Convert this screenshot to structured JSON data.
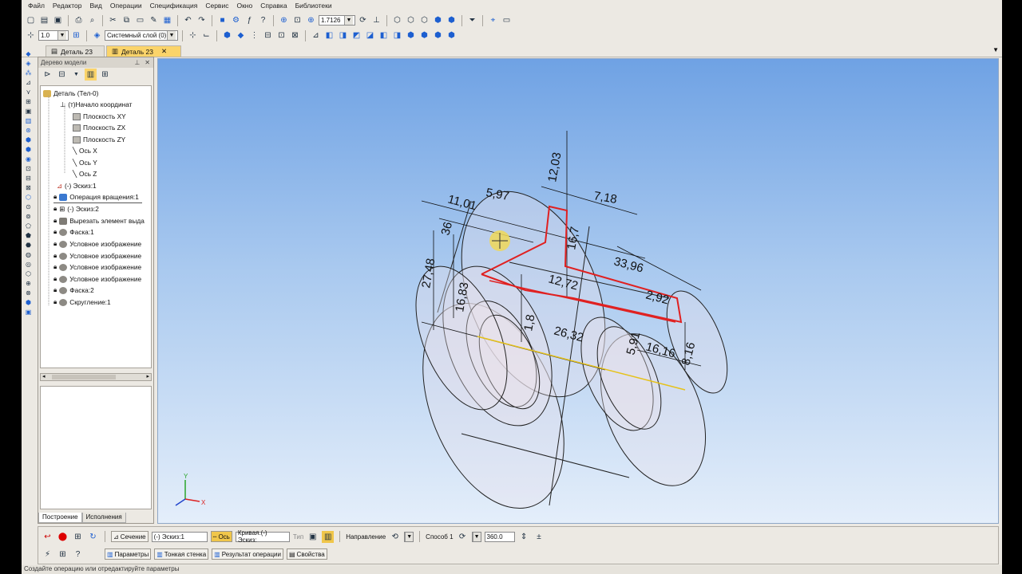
{
  "menu": {
    "items": [
      "Файл",
      "Редактор",
      "Вид",
      "Операции",
      "Спецификация",
      "Сервис",
      "Окно",
      "Справка",
      "Библиотеки"
    ]
  },
  "toolbar": {
    "zoom_value": "1.7126",
    "step_value": "1.0",
    "layer_value": "Системный слой (0)"
  },
  "tabs": [
    {
      "label": "Деталь 23",
      "active": false
    },
    {
      "label": "Деталь 23",
      "active": true
    }
  ],
  "tree_panel": {
    "title": "Дерево модели",
    "bottom_tabs": [
      "Построение",
      "Исполнения"
    ],
    "items": [
      {
        "label": "Деталь (Тел-0)"
      },
      {
        "label": "(т)Начало координат"
      },
      {
        "label": "Плоскость XY"
      },
      {
        "label": "Плоскость ZX"
      },
      {
        "label": "Плоскость ZY"
      },
      {
        "label": "Ось X"
      },
      {
        "label": "Ось Y"
      },
      {
        "label": "Ось Z"
      },
      {
        "label": "(-) Эскиз:1"
      },
      {
        "label": "Операция вращения:1"
      },
      {
        "label": "(-) Эскиз:2"
      },
      {
        "label": "Вырезать элемент выда"
      },
      {
        "label": "Фаска:1"
      },
      {
        "label": "Условное изображение"
      },
      {
        "label": "Условное изображение"
      },
      {
        "label": "Условное изображение"
      },
      {
        "label": "Условное изображение"
      },
      {
        "label": "Фаска:2"
      },
      {
        "label": "Скругление:1"
      }
    ]
  },
  "viewport": {
    "dimensions": [
      "11,01",
      "5,97",
      "12,03",
      "7,18",
      "36",
      "16,7",
      "27,48",
      "16,83",
      "33,96",
      "12,72",
      "2,92",
      "1,8",
      "26,32",
      "5,91",
      "16,16",
      "8,16"
    ],
    "axes": {
      "x": "X",
      "y": "Y"
    }
  },
  "properties": {
    "section_label": "Сечение",
    "section_value": "(-) Эскиз:1",
    "axis_label": "Ось",
    "axis_value": "Кривая.(-) Эскиз:",
    "type_label": "Тип",
    "direction_label": "Направление",
    "method_label": "Способ 1",
    "angle_value": "360.0",
    "tabs": [
      "Параметры",
      "Тонкая стенка",
      "Результат операции",
      "Свойства"
    ]
  },
  "status": {
    "text": "Создайте операцию или отредактируйте параметры"
  },
  "colors": {
    "accent_tab": "#fbd46a",
    "sketch_red": "#e02020",
    "axis_yellow": "#e6c21a"
  }
}
